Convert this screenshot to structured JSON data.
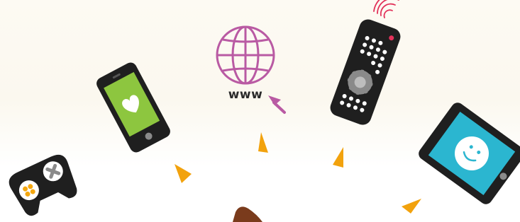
{
  "globe": {
    "label": "www"
  },
  "colors": {
    "device_body": "#1f1f1f",
    "phone_screen": "#8dc63f",
    "tablet_screen": "#2bb6d0",
    "globe": "#b95aa3",
    "signal": "#e2325a",
    "arrow_accent": "#f2a20d",
    "gamepad_accent": "#f4a70f",
    "brown_shape": "#7a3b1c"
  },
  "icons": [
    "gamepad-icon",
    "smartphone-icon",
    "heart-icon",
    "globe-icon",
    "cursor-icon",
    "remote-control-icon",
    "wifi-signal-icon",
    "tablet-icon",
    "smiley-icon",
    "triangle-arrow-icon"
  ]
}
